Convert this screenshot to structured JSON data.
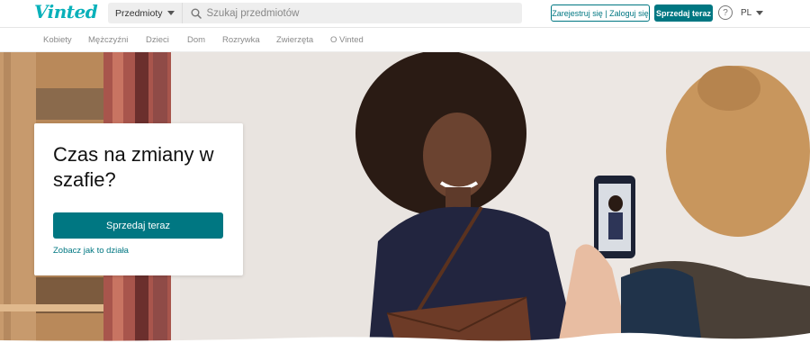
{
  "header": {
    "logo": "Vinted",
    "category_select": "Przedmioty",
    "search_placeholder": "Szukaj przedmiotów",
    "auth_button": "Zarejestruj się | Zaloguj się",
    "sell_button": "Sprzedaj teraz",
    "help_icon": "question-circle-icon",
    "help_glyph": "?",
    "language": "PL"
  },
  "nav": {
    "items": [
      "Kobiety",
      "Mężczyźni",
      "Dzieci",
      "Dom",
      "Rozrywka",
      "Zwierzęta",
      "O Vinted"
    ]
  },
  "hero": {
    "title": "Czas na zmiany w szafie?",
    "cta_button": "Sprzedaj teraz",
    "how_link": "Zobacz jak to działa"
  },
  "colors": {
    "brand": "#09b1ba",
    "accent": "#007782"
  }
}
